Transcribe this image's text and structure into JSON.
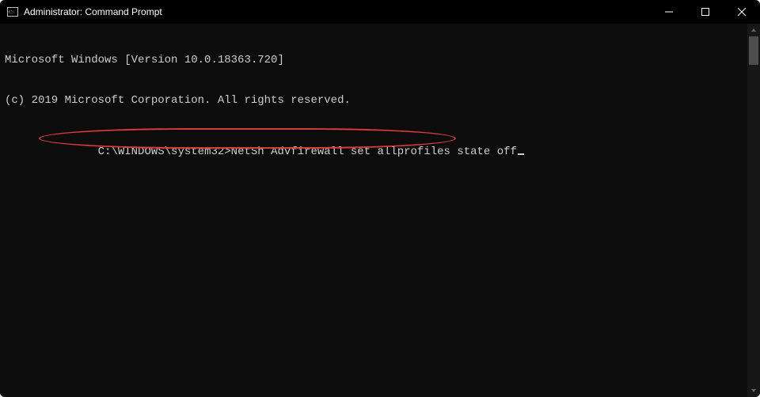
{
  "window": {
    "title": "Administrator: Command Prompt"
  },
  "terminal": {
    "line1": "Microsoft Windows [Version 10.0.18363.720]",
    "line2": "(c) 2019 Microsoft Corporation. All rights reserved.",
    "prompt": "C:\\WINDOWS\\system32>",
    "command": "NetSh Advfirewall set allprofiles state off"
  },
  "annotation": {
    "highlight_color": "#d93a3a"
  }
}
